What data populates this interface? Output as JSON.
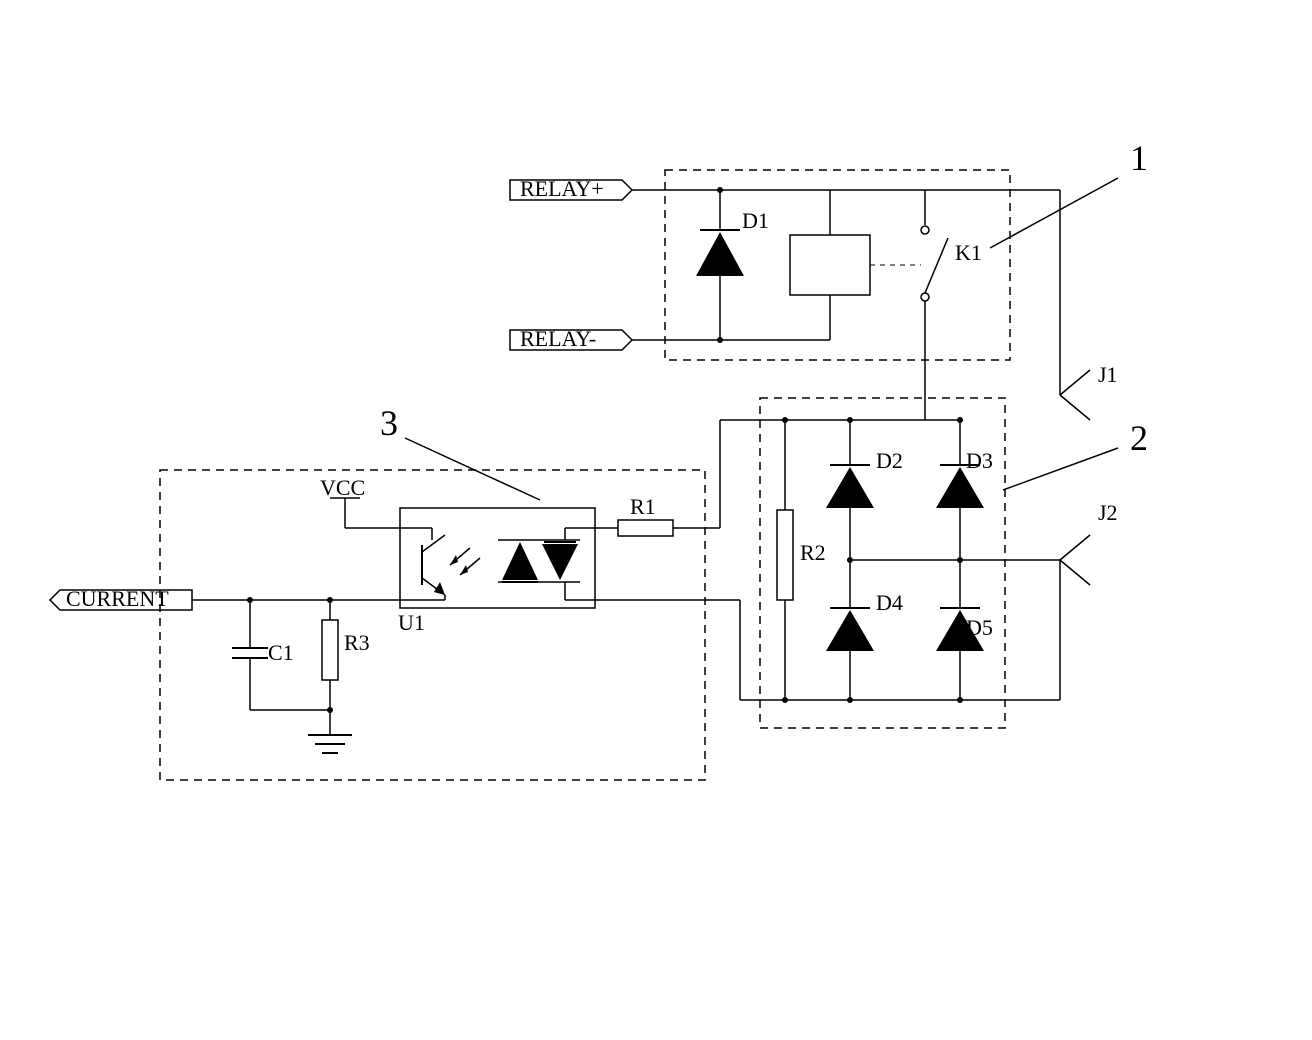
{
  "signals": {
    "relay_plus": "RELAY+",
    "relay_minus": "RELAY-",
    "vcc": "VCC",
    "current": "CURRENT"
  },
  "components": {
    "D1": "D1",
    "D2": "D2",
    "D3": "D3",
    "D4": "D4",
    "D5": "D5",
    "K1": "K1",
    "R1": "R1",
    "R2": "R2",
    "R3": "R3",
    "C1": "C1",
    "U1": "U1",
    "J1": "J1",
    "J2": "J2"
  },
  "blocks": {
    "b1": "1",
    "b2": "2",
    "b3": "3"
  }
}
